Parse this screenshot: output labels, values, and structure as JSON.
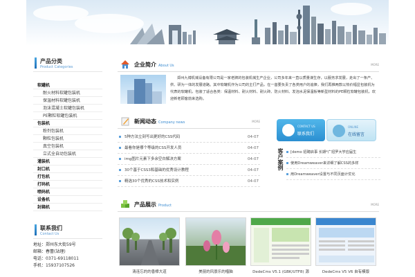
{
  "left": {
    "categories_title": "产品分类",
    "categories_subtitle": "Product Categories",
    "categories": [
      {
        "label": "软罐机",
        "level": "top"
      },
      {
        "label": "耐火材料软罐包装机",
        "level": "sub"
      },
      {
        "label": "保温材料软罐包装机",
        "level": "sub"
      },
      {
        "label": "泡沫混凝土软罐包装机",
        "level": "sub"
      },
      {
        "label": "PE颗粒软罐包装机",
        "level": "sub"
      },
      {
        "label": "包装机",
        "level": "top"
      },
      {
        "label": "粉剂包装机",
        "level": "sub"
      },
      {
        "label": "颗粒包装机",
        "level": "sub"
      },
      {
        "label": "真空包装机",
        "level": "sub"
      },
      {
        "label": "立式全自动包装机",
        "level": "sub"
      },
      {
        "label": "灌装机",
        "level": "top"
      },
      {
        "label": "封口机",
        "level": "top"
      },
      {
        "label": "打包机",
        "level": "top"
      },
      {
        "label": "打码机",
        "level": "top"
      },
      {
        "label": "喷码机",
        "level": "top"
      },
      {
        "label": "设备机",
        "level": "top"
      },
      {
        "label": "封箱机",
        "level": "top"
      }
    ],
    "contact_title": "联系我们",
    "contact_subtitle": "Contact Us",
    "contact_lines": [
      "地址：郑州东大街59号",
      "邮箱：春蕾(站理)",
      "电话：0371-69118011",
      "手机：15937107526"
    ]
  },
  "about": {
    "title": "企业简介",
    "subtitle": "About Us",
    "more": "MORE",
    "text": "郑州九博机械设备有限公司是一家老牌的包装机械生产企业，公司多年来一直以质量谋生存，以服务求发展，走出了一条产、供、研为一体的发展道路。其中软罐机作为公司的主打产品，在一首要负责了各类用户的追捧，我们再推两款以热价幅显包装机为代表的软罐机，包装了适合各类：保温材料、耐火材料、耐火砖、防火材料、发泡水泥保温板等新型材料的PE颗粒软罐包装机，欢迎新老顾客前来选购。"
  },
  "news": {
    "title": "新闻动态",
    "subtitle": "Company news",
    "more": "MORE",
    "items": [
      {
        "title": "5种方法立刻写出更好的CSS代码",
        "date": "04-07"
      },
      {
        "title": "最看你是哪个等级的CSS开发人员",
        "date": "04-07"
      },
      {
        "title": "img图片元素下多余空白解决方案",
        "date": "04-07"
      },
      {
        "title": "30个基于CSS3和基础的优秀设计教程",
        "date": "04-07"
      },
      {
        "title": "精选30个优秀的CSS技术和实例",
        "date": "04-07"
      }
    ]
  },
  "side": {
    "contact_btn_en": "CONTACT US",
    "contact_btn_cn": "联系我们",
    "online_btn_en": "ONLINE",
    "online_btn_cn": "在线留言",
    "cases_title": "客户案例",
    "cases": [
      "[demo 招聘启事 长期*广招罗大学应届生",
      "使用Dreamweaver来详细了解CSS的多样",
      "用Dreamweaver设置与不同页面计优化"
    ]
  },
  "products": {
    "title": "产品展示",
    "subtitle": "Product",
    "more": "MORE",
    "items": [
      {
        "caption": "清连忘的的香樟大道"
      },
      {
        "caption": "美丽的风景乐的楷脑"
      },
      {
        "caption": "DedeCms V5.1 (GBK/UTF8) 源"
      },
      {
        "caption": "DedeCms V5 V6 自有模版"
      }
    ]
  },
  "colors": {
    "accent": "#3a8bd0",
    "banner_sky": "#dbe9f5"
  }
}
